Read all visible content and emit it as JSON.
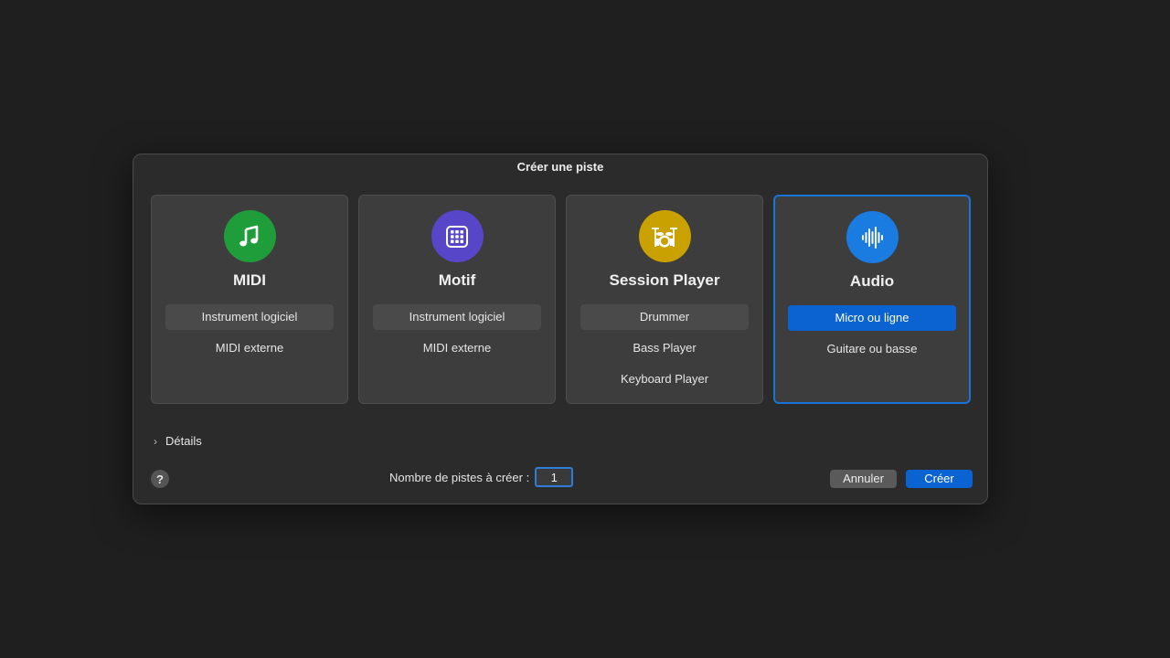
{
  "dialog": {
    "title": "Créer une piste"
  },
  "cards": [
    {
      "title": "MIDI",
      "icon": "music-note-icon",
      "icon_color": "#1f9d3a",
      "options": [
        {
          "label": "Instrument logiciel",
          "state": "default"
        },
        {
          "label": "MIDI externe",
          "state": "plain"
        }
      ]
    },
    {
      "title": "Motif",
      "icon": "grid-pads-icon",
      "icon_color": "#5746c7",
      "options": [
        {
          "label": "Instrument logiciel",
          "state": "default"
        },
        {
          "label": "MIDI externe",
          "state": "plain"
        }
      ]
    },
    {
      "title": "Session Player",
      "icon": "drum-kit-icon",
      "icon_color": "#c9a100",
      "options": [
        {
          "label": "Drummer",
          "state": "default"
        },
        {
          "label": "Bass Player",
          "state": "plain"
        },
        {
          "label": "Keyboard Player",
          "state": "plain"
        }
      ]
    },
    {
      "title": "Audio",
      "icon": "waveform-icon",
      "icon_color": "#1a7be0",
      "selected": true,
      "options": [
        {
          "label": "Micro ou ligne",
          "state": "active"
        },
        {
          "label": "Guitare ou basse",
          "state": "plain"
        }
      ]
    }
  ],
  "details": {
    "label": "Détails"
  },
  "help": {
    "label": "?"
  },
  "track_count": {
    "label": "Nombre de pistes à créer :",
    "value": "1"
  },
  "buttons": {
    "cancel": "Annuler",
    "create": "Créer"
  },
  "colors": {
    "accent": "#0b63d1",
    "background": "#1f1f1f",
    "dialog": "#2b2b2b",
    "card": "#3d3d3d"
  }
}
